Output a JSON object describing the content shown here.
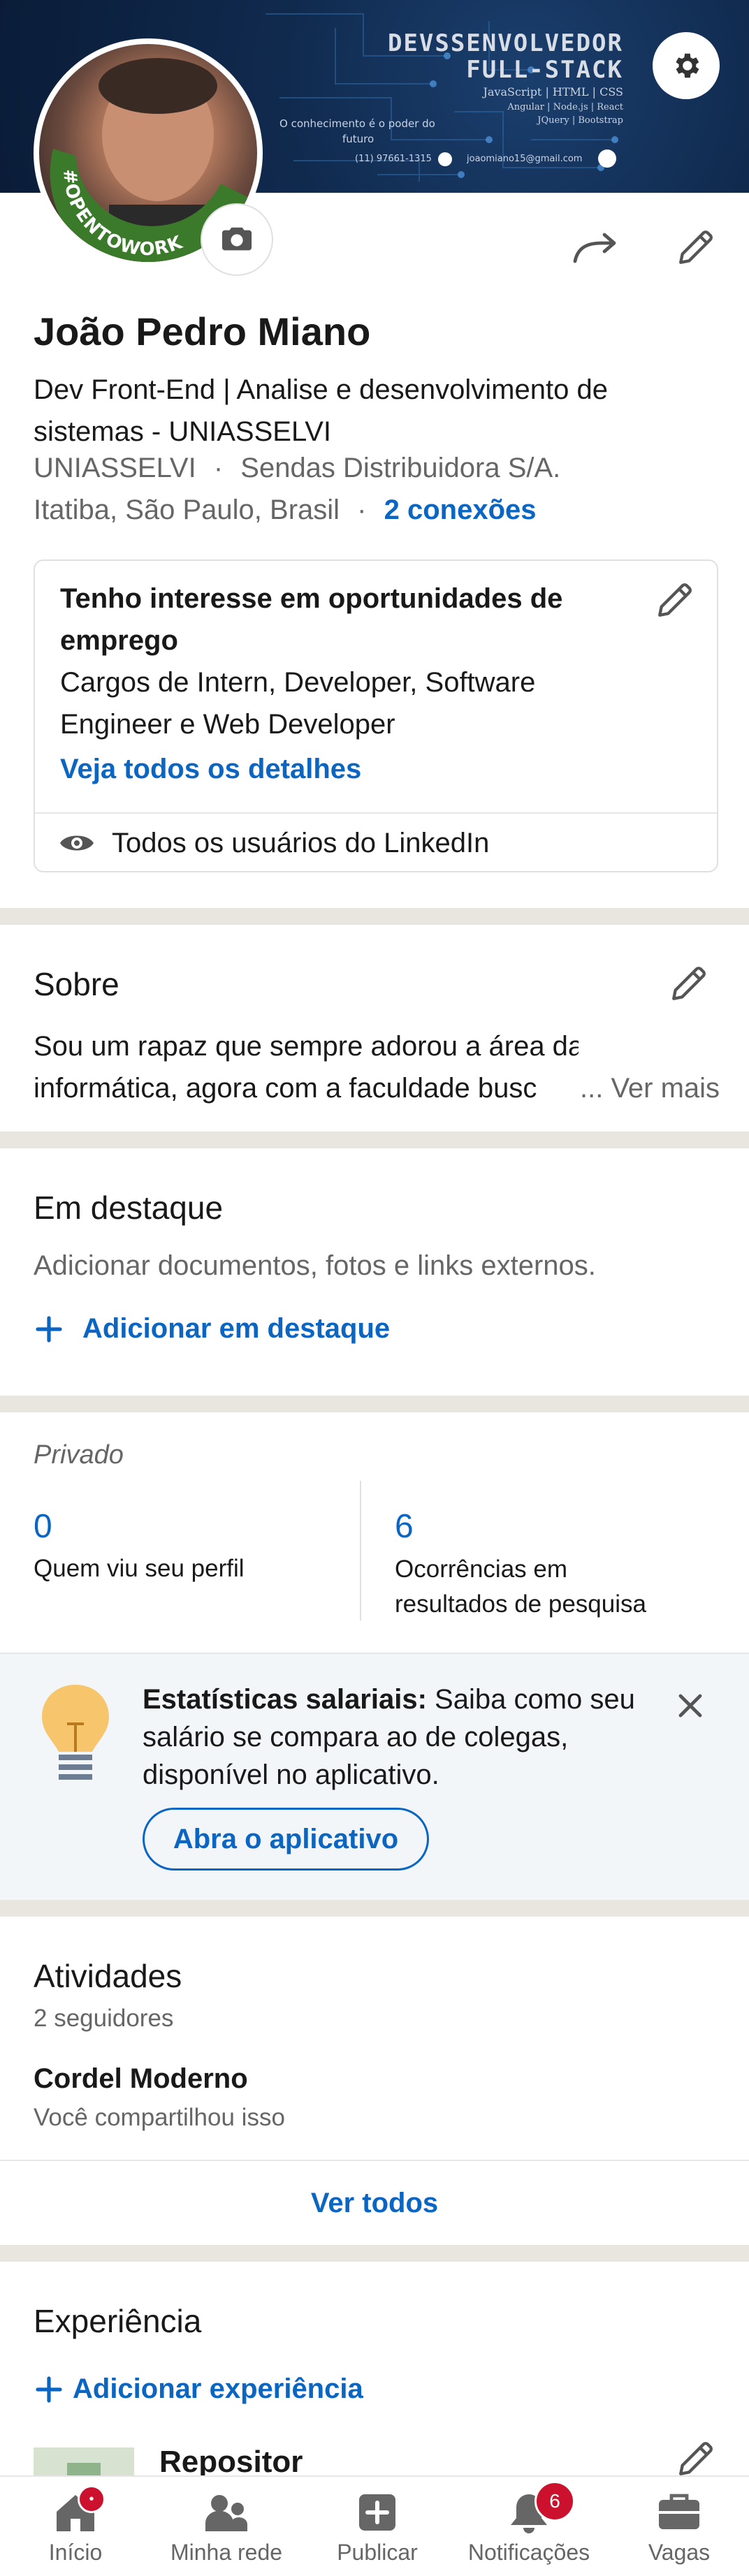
{
  "banner": {
    "line1": "DEVSSENVOLVEDOR",
    "line2": "FULL-STACK",
    "tech1": "JavaScript | HTML | CSS",
    "tech2": "Angular | Node.js | React",
    "tech3": "JQuery | Bootstrap",
    "quote1": "O conhecimento é o poder do",
    "quote2": "futuro",
    "phone": "(11) 97661-1315",
    "email": "joaomiano15@gmail.com",
    "avatar_frame_text": "#OPENTOWORK",
    "settings_icon": "gear-icon"
  },
  "profile": {
    "name": "João Pedro Miano",
    "headline_line1": "Dev Front-End | Analise e desenvolvimento de",
    "headline_line2": "sistemas - UNIASSELVI",
    "education": "UNIASSELVI",
    "employer": "Sendas Distribuidora S/A.",
    "location": "Itatiba, São Paulo, Brasil",
    "connections": "2 conexões",
    "separator": "·"
  },
  "open_to_work": {
    "title_line1": "Tenho interesse em oportunidades de",
    "title_line2": "emprego",
    "roles_line1": "Cargos de Intern, Developer, Software",
    "roles_line2": "Engineer e Web Developer",
    "details_link": "Veja todos os detalhes",
    "visibility": "Todos os usuários do LinkedIn"
  },
  "about": {
    "title": "Sobre",
    "line1": "Sou um rapaz que sempre adorou a área da",
    "line2": "informática, agora com a faculdade busc",
    "more": "... Ver mais"
  },
  "featured": {
    "title": "Em destaque",
    "description": "Adicionar documentos, fotos e links externos.",
    "add_link": "Adicionar em destaque"
  },
  "analytics": {
    "label": "Privado",
    "profile_views_count": "0",
    "profile_views_label": "Quem viu seu perfil",
    "search_count": "6",
    "search_label_line1": "Ocorrências em",
    "search_label_line2": "resultados de pesquisa"
  },
  "salary_promo": {
    "bold": "Estatísticas salariais:",
    "text_line1": " Saiba como seu",
    "text_line2": "salário se compara ao de colegas,",
    "text_line3": "disponível no aplicativo.",
    "button": "Abra o aplicativo"
  },
  "activity": {
    "title": "Atividades",
    "followers": "2 seguidores",
    "post_title": "Cordel Moderno",
    "post_subtitle": "Você compartilhou isso",
    "see_all": "Ver todos"
  },
  "experience": {
    "title": "Experiência",
    "add_link": "Adicionar experiência",
    "first_role": "Repositor"
  },
  "nav": {
    "home": "Início",
    "network": "Minha rede",
    "post": "Publicar",
    "notifications": "Notificações",
    "notifications_count": "6",
    "jobs": "Vagas"
  },
  "colors": {
    "link": "#0a66c2",
    "badge": "#cb112d",
    "separator": "#e9e5df",
    "opentowork_green": "#3b7a2a",
    "promo_bg": "#f3f6f8"
  }
}
